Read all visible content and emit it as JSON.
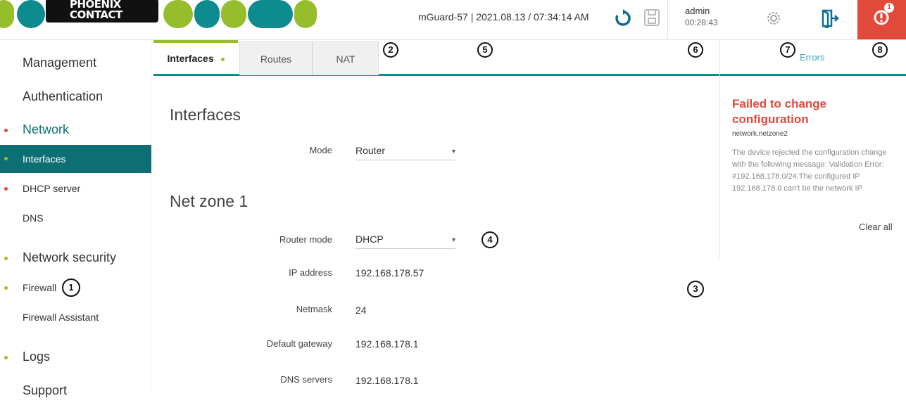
{
  "header": {
    "brand": "PHOENIX CONTACT",
    "device_info": "mGuard-57 | 2021.08.13 / 07:34:14 AM",
    "user": "admin",
    "session_time": "00:28:43",
    "error_count": "1",
    "icons": [
      "refresh-icon",
      "save-icon",
      "settings-icon",
      "logout-icon",
      "error-icon"
    ],
    "accent_green": "#96bd2b",
    "accent_teal": "#0d8b8f",
    "error_red": "#e1493b"
  },
  "sidebar": {
    "items": [
      {
        "label": "Management"
      },
      {
        "label": "Authentication"
      },
      {
        "label": "Network"
      },
      {
        "label": "Interfaces"
      },
      {
        "label": "DHCP server"
      },
      {
        "label": "DNS"
      },
      {
        "label": "Network security"
      },
      {
        "label": "Firewall"
      },
      {
        "label": "Firewall Assistant"
      },
      {
        "label": "Logs"
      },
      {
        "label": "Support"
      }
    ]
  },
  "tabs": [
    {
      "label": "Interfaces"
    },
    {
      "label": "Routes"
    },
    {
      "label": "NAT"
    }
  ],
  "callouts": [
    "1",
    "2",
    "3",
    "4",
    "5",
    "6",
    "7",
    "8"
  ],
  "main": {
    "section1_title": "Interfaces",
    "mode_label": "Mode",
    "mode_value": "Router",
    "section2_title": "Net zone 1",
    "router_mode_label": "Router mode",
    "router_mode_value": "DHCP",
    "ip_label": "IP address",
    "ip_value": "192.168.178.57",
    "netmask_label": "Netmask",
    "netmask_value": "24",
    "gateway_label": "Default gateway",
    "gateway_value": "192.168.178.1",
    "dns_label": "DNS servers",
    "dns_value": "192.168.178.1"
  },
  "errors": {
    "title": "Errors",
    "message_title": "Failed to change configuration",
    "path": "network.netzone2",
    "body": "The device rejected the configuration change with the following message: Validation Error: #192.168.178.0/24:The configured IP 192.168.178.0 can't be the network IP",
    "clear_all": "Clear all"
  }
}
